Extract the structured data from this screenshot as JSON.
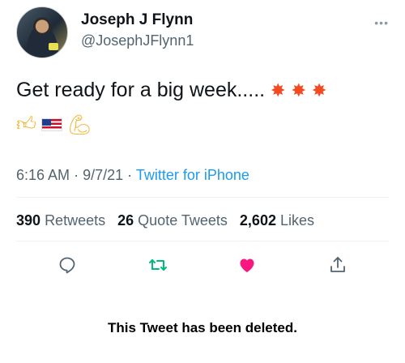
{
  "author": {
    "name": "Joseph J Flynn",
    "handle": "@JosephJFlynn1"
  },
  "tweet": {
    "text": "Get ready for a big week.....",
    "emojis": [
      "collision",
      "collision",
      "collision",
      "thumbs-up",
      "us-flag",
      "flexed-biceps"
    ],
    "time": "6:16 AM",
    "date": "9/7/21",
    "source": "Twitter for iPhone"
  },
  "stats": {
    "retweets_count": "390",
    "retweets_label": "Retweets",
    "quotes_count": "26",
    "quotes_label": "Quote Tweets",
    "likes_count": "2,602",
    "likes_label": "Likes"
  },
  "actions": [
    "reply-icon",
    "retweet-icon",
    "like-icon",
    "share-icon"
  ],
  "notice": "This Tweet has been deleted.",
  "colors": {
    "link": "#1d9bf0",
    "retweet": "#00ba7c",
    "like": "#f91880",
    "muted": "#536471"
  }
}
